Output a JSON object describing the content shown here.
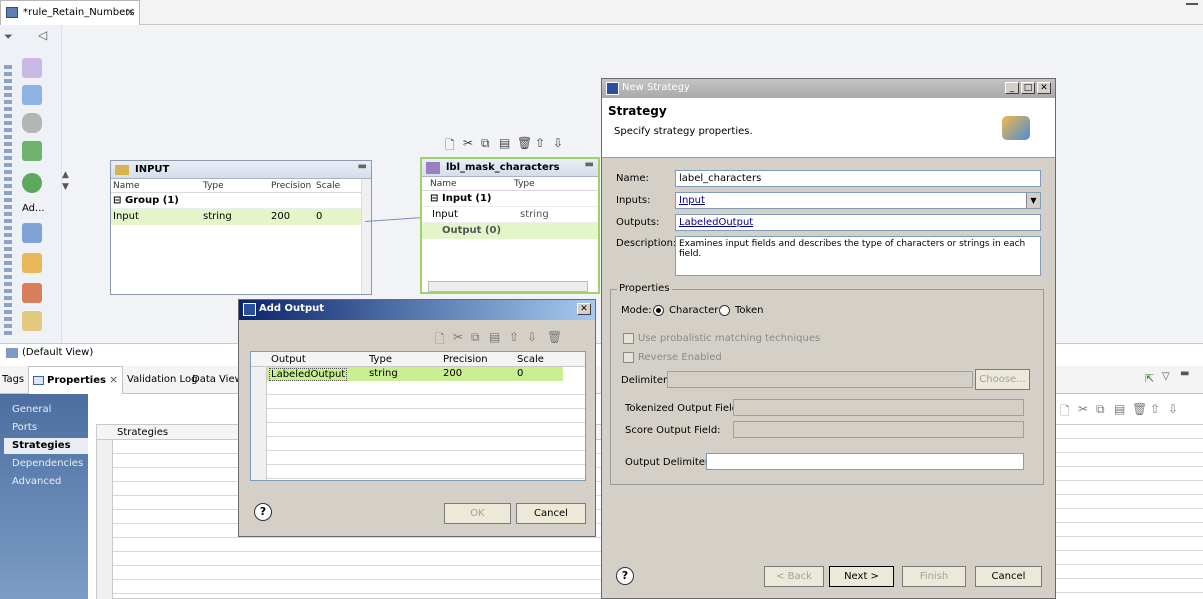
{
  "editor": {
    "tab_title": "*rule_Retain_Numbers",
    "close_glyph": "×"
  },
  "palette": {
    "active_label": "Ad..."
  },
  "input_box": {
    "title": "INPUT",
    "columns": [
      "Name",
      "Type",
      "Precision",
      "Scale"
    ],
    "group": "Group (1)",
    "row": {
      "name": "Input",
      "type": "string",
      "precision": "200",
      "scale": "0"
    }
  },
  "mask_box": {
    "title": "lbl_mask_characters",
    "columns": [
      "Name",
      "Type"
    ],
    "group": "Input (1)",
    "row": {
      "name": "Input",
      "type": "string"
    },
    "output_group": "Output (0)"
  },
  "bottom": {
    "default_view": "(Default View)",
    "tabs": {
      "tags": "Tags",
      "properties": "Properties",
      "validation_log": "Validation Log",
      "data_viewer": "Data Viewe"
    },
    "side_items": [
      "General",
      "Ports",
      "Strategies",
      "Dependencies",
      "Advanced"
    ],
    "strategies_header": "Strategies"
  },
  "add_output": {
    "title": "Add Output",
    "columns": [
      "Output",
      "Type",
      "Precision",
      "Scale"
    ],
    "row": {
      "output": "LabeledOutput",
      "type": "string",
      "precision": "200",
      "scale": "0"
    },
    "ok": "OK",
    "cancel": "Cancel"
  },
  "new_strategy": {
    "title": "New Strategy",
    "heading": "Strategy",
    "subheading": "Specify strategy properties.",
    "name_label": "Name:",
    "name_value": "label_characters",
    "inputs_label": "Inputs:",
    "inputs_value": "Input",
    "outputs_label": "Outputs:",
    "outputs_value": "LabeledOutput",
    "description_label": "Description:",
    "description_value": "Examines input fields and describes the type of characters or strings in each field.",
    "properties_label": "Properties",
    "mode_label": "Mode:",
    "mode_character": "Character",
    "mode_token": "Token",
    "mode_selected": "Character",
    "probabilistic_label": "Use probalistic matching techniques",
    "reverse_label": "Reverse Enabled",
    "delimiters_label": "Delimiters:",
    "choose_button": "Choose...",
    "tokenized_label": "Tokenized Output Field:",
    "score_label": "Score Output Field:",
    "output_delimiter_label": "Output Delimiter:",
    "back": "< Back",
    "next": "Next >",
    "finish": "Finish",
    "cancel": "Cancel"
  }
}
